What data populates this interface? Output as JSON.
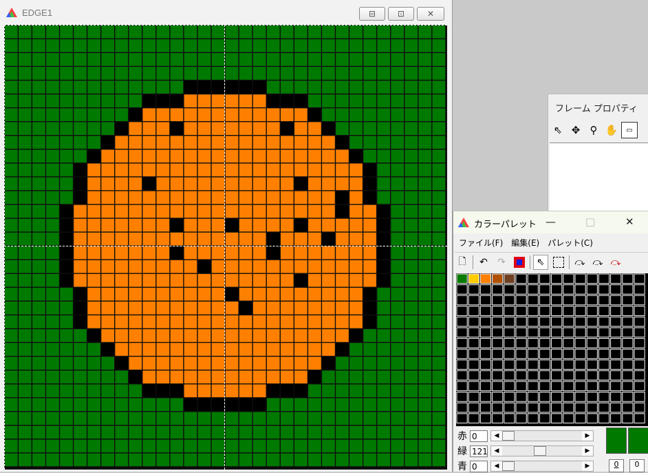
{
  "edge_window": {
    "title": "EDGE1",
    "minimize": "⊟",
    "maximize": "⊡",
    "close": "✕"
  },
  "frame_properties": {
    "title": "フレーム プロパティ",
    "tools": [
      "pointer-icon",
      "move-icon",
      "zoom-icon",
      "hand-icon",
      "frame-icon"
    ]
  },
  "palette_window": {
    "title": "カラーパレット",
    "minimize": "—",
    "maximize": "□",
    "close": "✕",
    "menu": [
      "ファイル(F)",
      "編集(E)",
      "パレット(C)"
    ],
    "swatches": [
      "#0a7a00",
      "#ffcc00",
      "#ff8000",
      "#b05000",
      "#704020"
    ],
    "rgb": {
      "r_label": "赤",
      "r_value": "0",
      "g_label": "緑",
      "g_value": "121",
      "b_label": "青",
      "b_value": "0"
    },
    "fg_color": "#007900",
    "bottom_values": [
      "0",
      "0"
    ]
  },
  "colors": {
    "green": "#007900",
    "orange": "#ff8000",
    "black": "#000000",
    "grid": "#0e0e0e"
  }
}
